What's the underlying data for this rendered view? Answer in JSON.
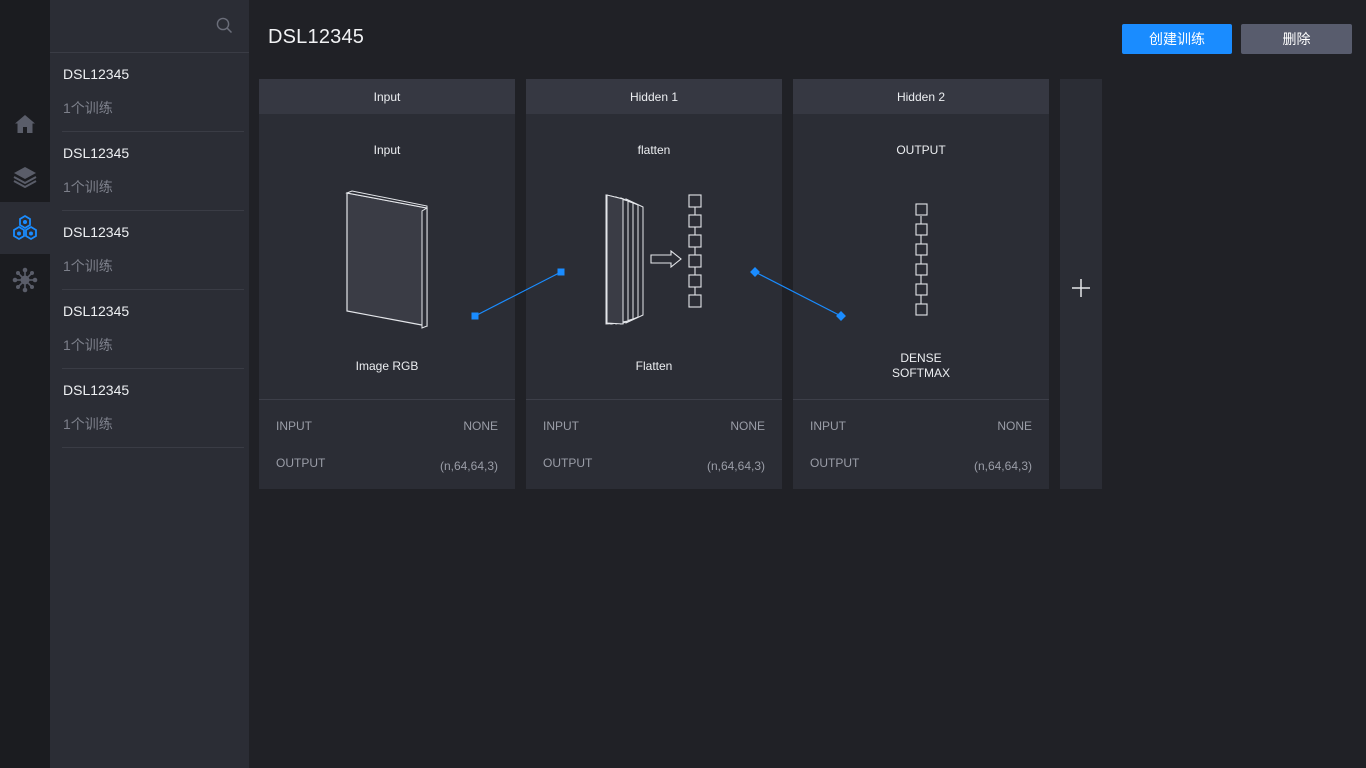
{
  "nav": {
    "items": [
      {
        "icon": "home-icon"
      },
      {
        "icon": "layers-icon"
      },
      {
        "icon": "model-icon",
        "active": true
      },
      {
        "icon": "network-icon"
      }
    ]
  },
  "search": {
    "icon": "search-icon"
  },
  "list": [
    {
      "name": "DSL12345",
      "sub": "1个训练"
    },
    {
      "name": "DSL12345",
      "sub": "1个训练"
    },
    {
      "name": "DSL12345",
      "sub": "1个训练"
    },
    {
      "name": "DSL12345",
      "sub": "1个训练"
    },
    {
      "name": "DSL12345",
      "sub": "1个训练"
    }
  ],
  "header": {
    "title": "DSL12345",
    "create_label": "创建训练",
    "delete_label": "删除"
  },
  "layers": [
    {
      "header": "Input",
      "label": "Input",
      "caption": "Image  RGB",
      "input_key": "INPUT",
      "input_value": "NONE",
      "output_key": "OUTPUT",
      "output_value": "(n,64,64,3)"
    },
    {
      "header": "Hidden 1",
      "label": "flatten",
      "caption": "Flatten",
      "input_key": "INPUT",
      "input_value": "NONE",
      "output_key": "OUTPUT",
      "output_value": "(n,64,64,3)"
    },
    {
      "header": "Hidden 2",
      "label": "OUTPUT",
      "caption_line1": "DENSE",
      "caption_line2": "SOFTMAX",
      "input_key": "INPUT",
      "input_value": "NONE",
      "output_key": "OUTPUT",
      "output_value": "(n,64,64,3)"
    }
  ],
  "add_layer": {
    "icon": "plus-icon"
  },
  "colors": {
    "accent": "#1a8cff",
    "secondary_button": "#585c6d",
    "panel": "#2b2d35",
    "background": "#202126"
  }
}
